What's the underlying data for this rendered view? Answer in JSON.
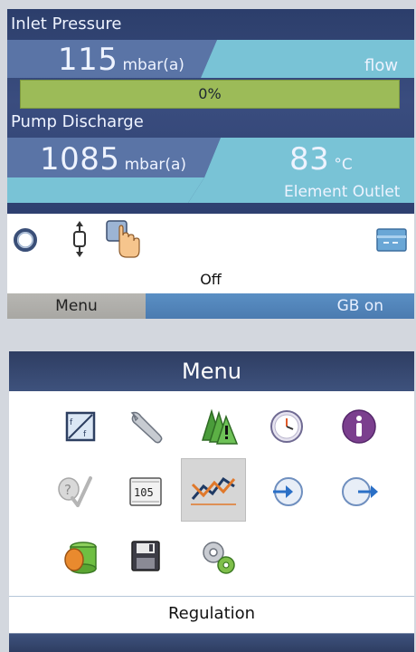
{
  "screen1": {
    "inlet_title": "Inlet Pressure",
    "inlet_value": "115",
    "inlet_unit": "mbar(a)",
    "flow_label": "flow",
    "progress_percent": 0,
    "progress_label": "0%",
    "pump_title": "Pump Discharge",
    "pump_value": "1085",
    "pump_unit": "mbar(a)",
    "temp_value": "83",
    "temp_unit": "°C",
    "temp_label": "Element Outlet",
    "status": "Off",
    "menu_button": "Menu",
    "right_button": "GB on"
  },
  "screen2": {
    "title": "Menu",
    "selected_caption": "Regulation",
    "icons": [
      "setpoint-ratio-icon",
      "wrench-icon",
      "warning-triangles-icon",
      "clock-icon",
      "info-icon",
      "service-check-icon",
      "counter-icon",
      "regulation-icon",
      "input-icon",
      "output-icon",
      "database-icon",
      "save-icon",
      "settings-gears-icon"
    ]
  }
}
